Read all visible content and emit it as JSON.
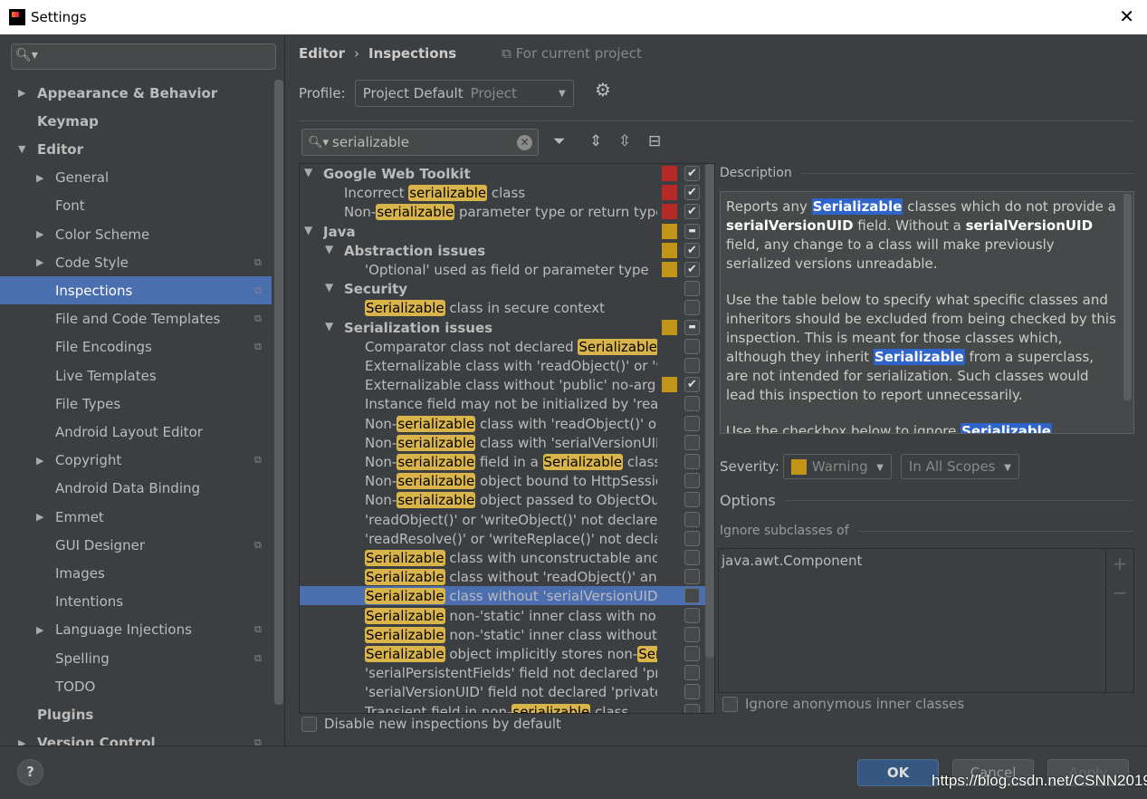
{
  "window": {
    "title": "Settings",
    "close_icon": "close-icon"
  },
  "sidebar": {
    "search_placeholder": "",
    "items": [
      {
        "label": "Appearance & Behavior",
        "level": 0,
        "arrow": "right",
        "bold": true
      },
      {
        "label": "Keymap",
        "level": 0,
        "bold": true
      },
      {
        "label": "Editor",
        "level": 0,
        "arrow": "down",
        "bold": true
      },
      {
        "label": "General",
        "level": 1,
        "arrow": "right"
      },
      {
        "label": "Font",
        "level": 1
      },
      {
        "label": "Color Scheme",
        "level": 1,
        "arrow": "right"
      },
      {
        "label": "Code Style",
        "level": 1,
        "arrow": "right",
        "project": true
      },
      {
        "label": "Inspections",
        "level": 1,
        "selected": true,
        "project": true
      },
      {
        "label": "File and Code Templates",
        "level": 1,
        "project": true
      },
      {
        "label": "File Encodings",
        "level": 1,
        "project": true
      },
      {
        "label": "Live Templates",
        "level": 1
      },
      {
        "label": "File Types",
        "level": 1
      },
      {
        "label": "Android Layout Editor",
        "level": 1
      },
      {
        "label": "Copyright",
        "level": 1,
        "arrow": "right",
        "project": true
      },
      {
        "label": "Android Data Binding",
        "level": 1
      },
      {
        "label": "Emmet",
        "level": 1,
        "arrow": "right"
      },
      {
        "label": "GUI Designer",
        "level": 1,
        "project": true
      },
      {
        "label": "Images",
        "level": 1
      },
      {
        "label": "Intentions",
        "level": 1
      },
      {
        "label": "Language Injections",
        "level": 1,
        "arrow": "right",
        "project": true
      },
      {
        "label": "Spelling",
        "level": 1,
        "project": true
      },
      {
        "label": "TODO",
        "level": 1
      },
      {
        "label": "Plugins",
        "level": 0,
        "bold": true
      },
      {
        "label": "Version Control",
        "level": 0,
        "arrow": "right",
        "bold": true,
        "project": true
      }
    ]
  },
  "breadcrumb": {
    "parent": "Editor",
    "sep": "›",
    "current": "Inspections",
    "scope": "For current project"
  },
  "profile": {
    "label": "Profile:",
    "value": "Project Default",
    "hint": "Project"
  },
  "filter": {
    "value": "serializable"
  },
  "colors": {
    "error": "#b52a27",
    "warning": "#c29418",
    "selection": "#4b6eaf",
    "highlight": "#d9b44a"
  },
  "tree": [
    {
      "level": 0,
      "bold": true,
      "arrow": true,
      "sev": "error",
      "check": "checked",
      "parts": [
        {
          "t": "Google Web Toolkit"
        }
      ]
    },
    {
      "level": 1,
      "sev": "error",
      "check": "checked",
      "parts": [
        {
          "t": "Incorrect "
        },
        {
          "t": "serializable",
          "hl": true
        },
        {
          "t": " class"
        }
      ]
    },
    {
      "level": 1,
      "sev": "error",
      "check": "checked",
      "parts": [
        {
          "t": "Non-"
        },
        {
          "t": "serializable",
          "hl": true
        },
        {
          "t": " parameter type or return type in"
        }
      ]
    },
    {
      "level": 0,
      "bold": true,
      "arrow": true,
      "sev": "warning",
      "check": "mixed",
      "parts": [
        {
          "t": "Java"
        }
      ]
    },
    {
      "level": 1,
      "bold": true,
      "arrow": true,
      "sev": "warning",
      "check": "checked",
      "parts": [
        {
          "t": "Abstraction issues"
        }
      ]
    },
    {
      "level": 2,
      "sev": "warning",
      "check": "checked",
      "parts": [
        {
          "t": "'Optional' used as field or parameter type"
        }
      ]
    },
    {
      "level": 1,
      "bold": true,
      "arrow": true,
      "check": "none",
      "parts": [
        {
          "t": "Security"
        }
      ]
    },
    {
      "level": 2,
      "check": "none",
      "parts": [
        {
          "t": "Serializable",
          "hl": true
        },
        {
          "t": " class in secure context"
        }
      ]
    },
    {
      "level": 1,
      "bold": true,
      "arrow": true,
      "sev": "warning",
      "check": "mixed",
      "parts": [
        {
          "t": "Serialization issues"
        }
      ]
    },
    {
      "level": 2,
      "check": "none",
      "parts": [
        {
          "t": "Comparator class not declared "
        },
        {
          "t": "Serializable",
          "hl": true
        }
      ]
    },
    {
      "level": 2,
      "check": "none",
      "parts": [
        {
          "t": "Externalizable class with 'readObject()' or 'writeObject()'"
        }
      ]
    },
    {
      "level": 2,
      "sev": "warning",
      "check": "checked",
      "parts": [
        {
          "t": "Externalizable class without 'public' no-arg constructor"
        }
      ]
    },
    {
      "level": 2,
      "check": "none",
      "parts": [
        {
          "t": "Instance field may not be initialized by 'readObject()'"
        }
      ]
    },
    {
      "level": 2,
      "check": "none",
      "parts": [
        {
          "t": "Non-"
        },
        {
          "t": "serializable",
          "hl": true
        },
        {
          "t": " class with 'readObject()' or 'writeObject()'"
        }
      ]
    },
    {
      "level": 2,
      "check": "none",
      "parts": [
        {
          "t": "Non-"
        },
        {
          "t": "serializable",
          "hl": true
        },
        {
          "t": " class with 'serialVersionUID'"
        }
      ]
    },
    {
      "level": 2,
      "check": "none",
      "parts": [
        {
          "t": "Non-"
        },
        {
          "t": "serializable",
          "hl": true
        },
        {
          "t": " field in a "
        },
        {
          "t": "Serializable",
          "hl": true
        },
        {
          "t": " class"
        }
      ]
    },
    {
      "level": 2,
      "check": "none",
      "parts": [
        {
          "t": "Non-"
        },
        {
          "t": "serializable",
          "hl": true
        },
        {
          "t": " object bound to HttpSession"
        }
      ]
    },
    {
      "level": 2,
      "check": "none",
      "parts": [
        {
          "t": "Non-"
        },
        {
          "t": "serializable",
          "hl": true
        },
        {
          "t": " object passed to ObjectOutputStream"
        }
      ]
    },
    {
      "level": 2,
      "check": "none",
      "parts": [
        {
          "t": "'readObject()' or 'writeObject()' not declared 'private'"
        }
      ]
    },
    {
      "level": 2,
      "check": "none",
      "parts": [
        {
          "t": "'readResolve()' or 'writeReplace()' not declared 'protected'"
        }
      ]
    },
    {
      "level": 2,
      "check": "none",
      "parts": [
        {
          "t": "Serializable",
          "hl": true
        },
        {
          "t": " class with unconstructable ancestor"
        }
      ]
    },
    {
      "level": 2,
      "check": "none",
      "parts": [
        {
          "t": "Serializable",
          "hl": true
        },
        {
          "t": " class without 'readObject()' and 'writeObject()'"
        }
      ]
    },
    {
      "level": 2,
      "check": "none",
      "selected": true,
      "parts": [
        {
          "t": "Serializable",
          "hl": true
        },
        {
          "t": " class without 'serialVersionUID'"
        }
      ]
    },
    {
      "level": 2,
      "check": "none",
      "parts": [
        {
          "t": "Serializable",
          "hl": true
        },
        {
          "t": " non-'static' inner class with non-"
        },
        {
          "t": "Serializable",
          "hl": true
        }
      ]
    },
    {
      "level": 2,
      "check": "none",
      "parts": [
        {
          "t": "Serializable",
          "hl": true
        },
        {
          "t": " non-'static' inner class without 'serialVersionUID'"
        }
      ]
    },
    {
      "level": 2,
      "check": "none",
      "parts": [
        {
          "t": "Serializable",
          "hl": true
        },
        {
          "t": " object implicitly stores non-"
        },
        {
          "t": "Serializable",
          "hl": true
        }
      ]
    },
    {
      "level": 2,
      "check": "none",
      "parts": [
        {
          "t": "'serialPersistentFields' field not declared 'private static final'"
        }
      ]
    },
    {
      "level": 2,
      "check": "none",
      "parts": [
        {
          "t": "'serialVersionUID' field not declared 'private static final'"
        }
      ]
    },
    {
      "level": 2,
      "check": "none",
      "parts": [
        {
          "t": "Transient field in non-"
        },
        {
          "t": "serializable",
          "hl": true
        },
        {
          "t": " class"
        }
      ]
    }
  ],
  "disable_new": "Disable new inspections by default",
  "description": {
    "header": "Description",
    "p1": [
      {
        "t": "Reports any "
      },
      {
        "t": "Serializable",
        "hl": true
      },
      {
        "t": " classes which do not provide a "
      },
      {
        "t": "serialVersionUID",
        "b": true
      },
      {
        "t": " field. Without a "
      },
      {
        "t": "serialVersionUID",
        "b": true
      },
      {
        "t": " field, any change to a class will make previously serialized versions unreadable."
      }
    ],
    "p2": [
      {
        "t": "Use the table below to specify what specific classes and inheritors should be excluded from being checked by this inspection. This is meant for those classes which, although they inherit "
      },
      {
        "t": "Serializable",
        "hl": true
      },
      {
        "t": " from a superclass, are not intended for serialization. Such classes would lead this inspection to report unnecessarily."
      }
    ],
    "p3": [
      {
        "t": "Use the checkbox below to ignore "
      },
      {
        "t": "Serializable",
        "hl": true
      }
    ]
  },
  "severity": {
    "label": "Severity:",
    "value": "Warning",
    "scope": "In All Scopes"
  },
  "options": {
    "header": "Options",
    "ignore_header": "Ignore subclasses of",
    "ignore_items": [
      "java.awt.Component"
    ],
    "add": "+",
    "remove": "−",
    "anon_label": "Ignore anonymous inner classes"
  },
  "footer": {
    "help": "?",
    "ok": "OK",
    "cancel": "Cancel",
    "apply": "Apply"
  },
  "watermark": "https://blog.csdn.net/CSNN2019"
}
